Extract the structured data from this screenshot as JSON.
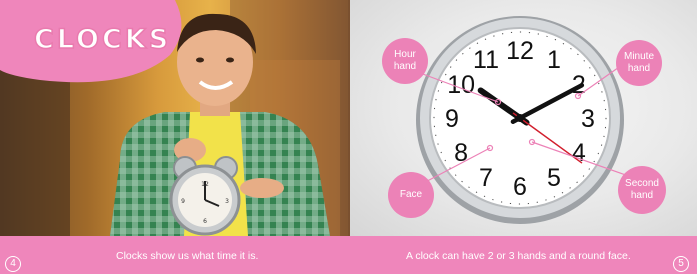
{
  "page_title": "CLOCKS",
  "callouts": {
    "hour": "Hour\nhand",
    "minute": "Minute\nhand",
    "face": "Face",
    "second": "Second\nhand"
  },
  "clock_numbers": [
    "12",
    "1",
    "2",
    "3",
    "4",
    "5",
    "6",
    "7",
    "8",
    "9",
    "10",
    "11"
  ],
  "clock_time": {
    "hour": 10,
    "minute": 10,
    "second": 21
  },
  "captions": {
    "left": "Clocks show us what time it is.",
    "right": "A clock can have 2 or 3 hands and a round face."
  },
  "page_numbers": {
    "left": "4",
    "right": "5"
  },
  "colors": {
    "accent": "#ef86bb",
    "callout": "#ec82b7",
    "second_hand": "#d21f2d"
  }
}
